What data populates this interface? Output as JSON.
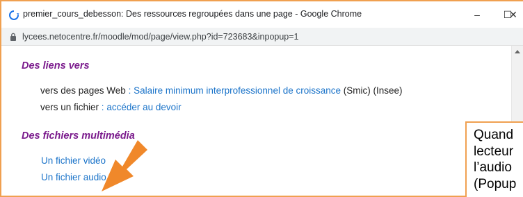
{
  "window": {
    "title": "premier_cours_debesson: Des ressources regroupées dans une page - Google Chrome",
    "url": "lycees.netocentre.fr/moodle/mod/page/view.php?id=723683&inpopup=1",
    "minimize_symbol": "–",
    "maximize_symbol": "☐",
    "close_symbol": "✕"
  },
  "page": {
    "section1": {
      "heading": "Des liens vers",
      "line1": {
        "prefix": "vers des pages Web ",
        "separator": ":",
        "link": "Salaire minimum interprofessionnel de croissance",
        "suffix": " (Smic) (Insee)"
      },
      "line2": {
        "prefix": "vers un fichier ",
        "separator": ":",
        "link": "accéder au devoir"
      }
    },
    "section2": {
      "heading": "Des fichiers multimédia",
      "video_link": "Un fichier vidéo",
      "audio_link": "Un fichier audio"
    }
  },
  "callout": {
    "lines": [
      "Quand",
      "lecteur",
      "l’audio",
      "(Popup"
    ]
  },
  "colors": {
    "accent_orange": "#f0a050",
    "arrow_orange": "#f0882a",
    "heading_purple": "#7a1a8c",
    "link_blue": "#1a73c9"
  },
  "icons": {
    "tab_icon": "loading-spinner-icon",
    "address_icon": "lock-icon",
    "annotation": "orange-arrow-icon"
  }
}
